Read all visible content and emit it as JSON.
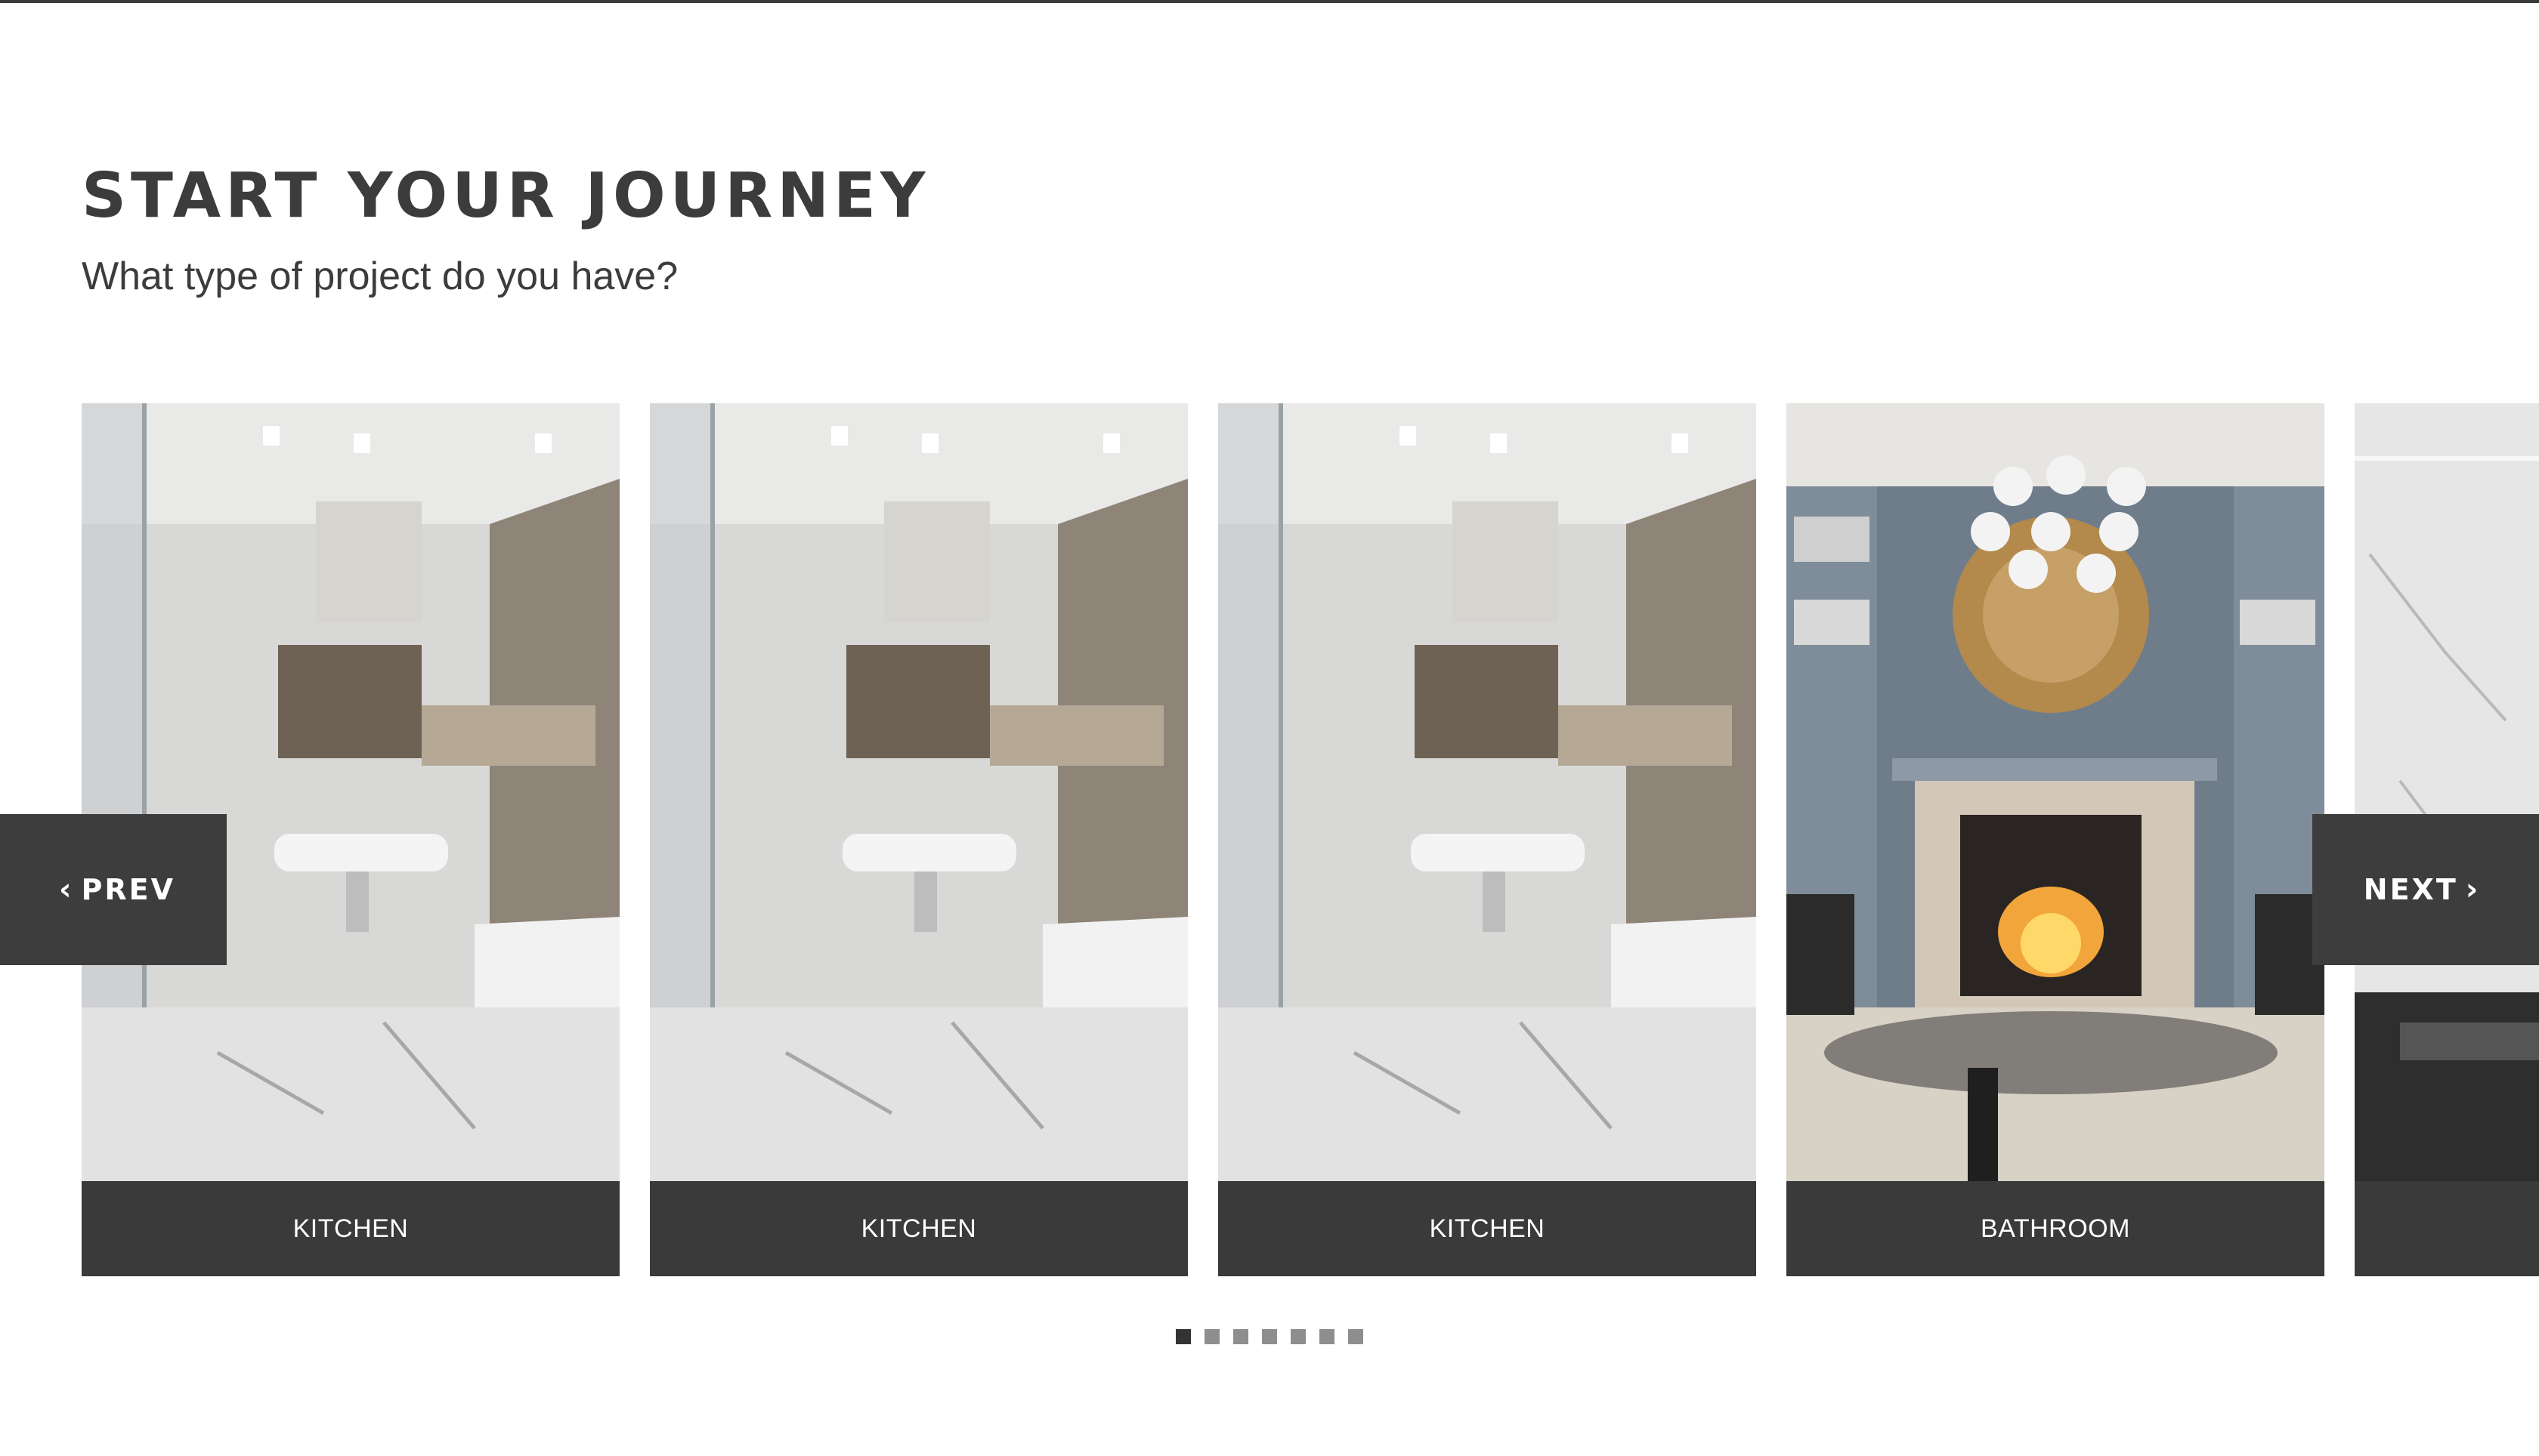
{
  "page": {
    "heading": "START YOUR JOURNEY",
    "subheading": "What type of project do you have?"
  },
  "carousel": {
    "prev_label": "PREV",
    "next_label": "NEXT",
    "cards": [
      {
        "label": "KITCHEN",
        "image": "bathroom-photo"
      },
      {
        "label": "KITCHEN",
        "image": "bathroom-photo"
      },
      {
        "label": "KITCHEN",
        "image": "bathroom-photo"
      },
      {
        "label": "BATHROOM",
        "image": "living-room-fireplace-photo"
      },
      {
        "label": "",
        "image": "marble-wall-photo"
      }
    ],
    "dots": {
      "count": 7,
      "active_index": 0
    }
  },
  "colors": {
    "text": "#3c3c3c",
    "caption_bg": "#3a3a3a",
    "nav_bg": "#3d3d3d",
    "dot_inactive": "#8e8e8e",
    "dot_active": "#333333"
  }
}
